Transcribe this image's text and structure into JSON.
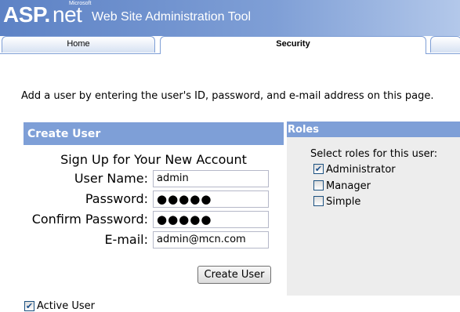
{
  "app": {
    "logo_asp": "ASP",
    "logo_dot": ".",
    "logo_net": "net",
    "logo_ms": "Microsoft",
    "title": "Web Site Administration Tool"
  },
  "tabs": [
    {
      "label": "Home",
      "active": false
    },
    {
      "label": "Security",
      "active": true
    }
  ],
  "instruction": "Add a user by entering the user's ID, password, and e-mail address on this page.",
  "create_user": {
    "header": "Create User",
    "form_title": "Sign Up for Your New Account",
    "fields": {
      "username": {
        "label": "User Name:",
        "value": "admin"
      },
      "password": {
        "label": "Password:",
        "value": "●●●●●"
      },
      "confirm": {
        "label": "Confirm Password:",
        "value": "●●●●●"
      },
      "email": {
        "label": "E-mail:",
        "value": "admin@mcn.com"
      }
    },
    "button": "Create User",
    "active_user": {
      "label": "Active User",
      "checked": true
    }
  },
  "roles": {
    "header": "Roles",
    "prompt": "Select roles for this user:",
    "items": [
      {
        "label": "Administrator",
        "checked": true
      },
      {
        "label": "Manager",
        "checked": false
      },
      {
        "label": "Simple",
        "checked": false
      }
    ]
  },
  "colors": {
    "header_blue": "#7e9fd7",
    "panel_gray": "#ededed"
  }
}
